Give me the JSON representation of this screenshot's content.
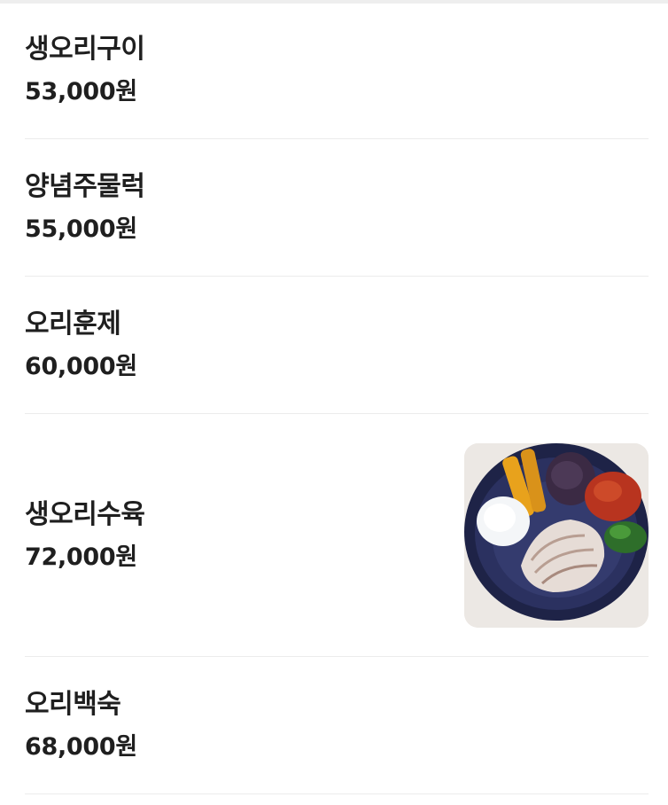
{
  "menu": {
    "items": [
      {
        "name": "생오리구이",
        "price": "53,000원",
        "has_photo": false
      },
      {
        "name": "양념주물럭",
        "price": "55,000원",
        "has_photo": false
      },
      {
        "name": "오리훈제",
        "price": "60,000원",
        "has_photo": false
      },
      {
        "name": "생오리수육",
        "price": "72,000원",
        "has_photo": true,
        "photo_icon": "duck-suyuk-dish-photo"
      },
      {
        "name": "오리백숙",
        "price": "68,000원",
        "has_photo": false
      }
    ]
  },
  "colors": {
    "text": "#1f1f1f",
    "divider": "#ececec",
    "photo_background": "#ece8e4",
    "plate": "#23284f"
  }
}
